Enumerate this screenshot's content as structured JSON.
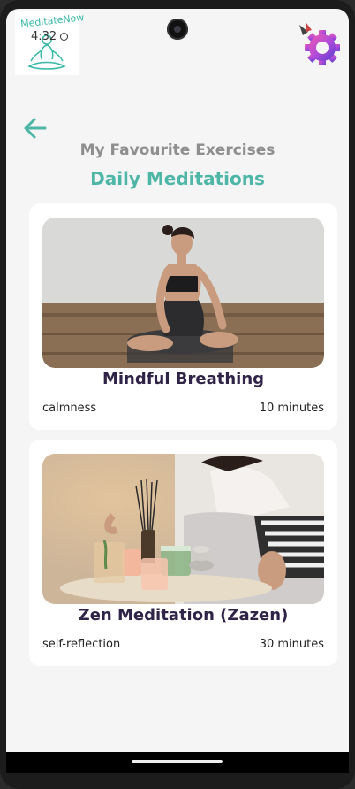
{
  "status_bar": {
    "time": "4:32"
  },
  "logo": {
    "text": "MeditateNow"
  },
  "header": {
    "subtitle": "My Favourite Exercises",
    "title": "Daily Meditations"
  },
  "exercises": [
    {
      "title": "Mindful Breathing",
      "tag": "calmness",
      "duration": "10 minutes",
      "image": "woman-yoga-pose-photo"
    },
    {
      "title": "Zen Meditation (Zazen)",
      "tag": "self-reflection",
      "duration": "30 minutes",
      "image": "candles-meditation-photo"
    }
  ],
  "icons": {
    "back": "arrow-left-icon",
    "settings": "gear-icon"
  },
  "colors": {
    "accent": "#4db6a6",
    "title": "#2f2447",
    "muted": "#8e8e8e"
  }
}
